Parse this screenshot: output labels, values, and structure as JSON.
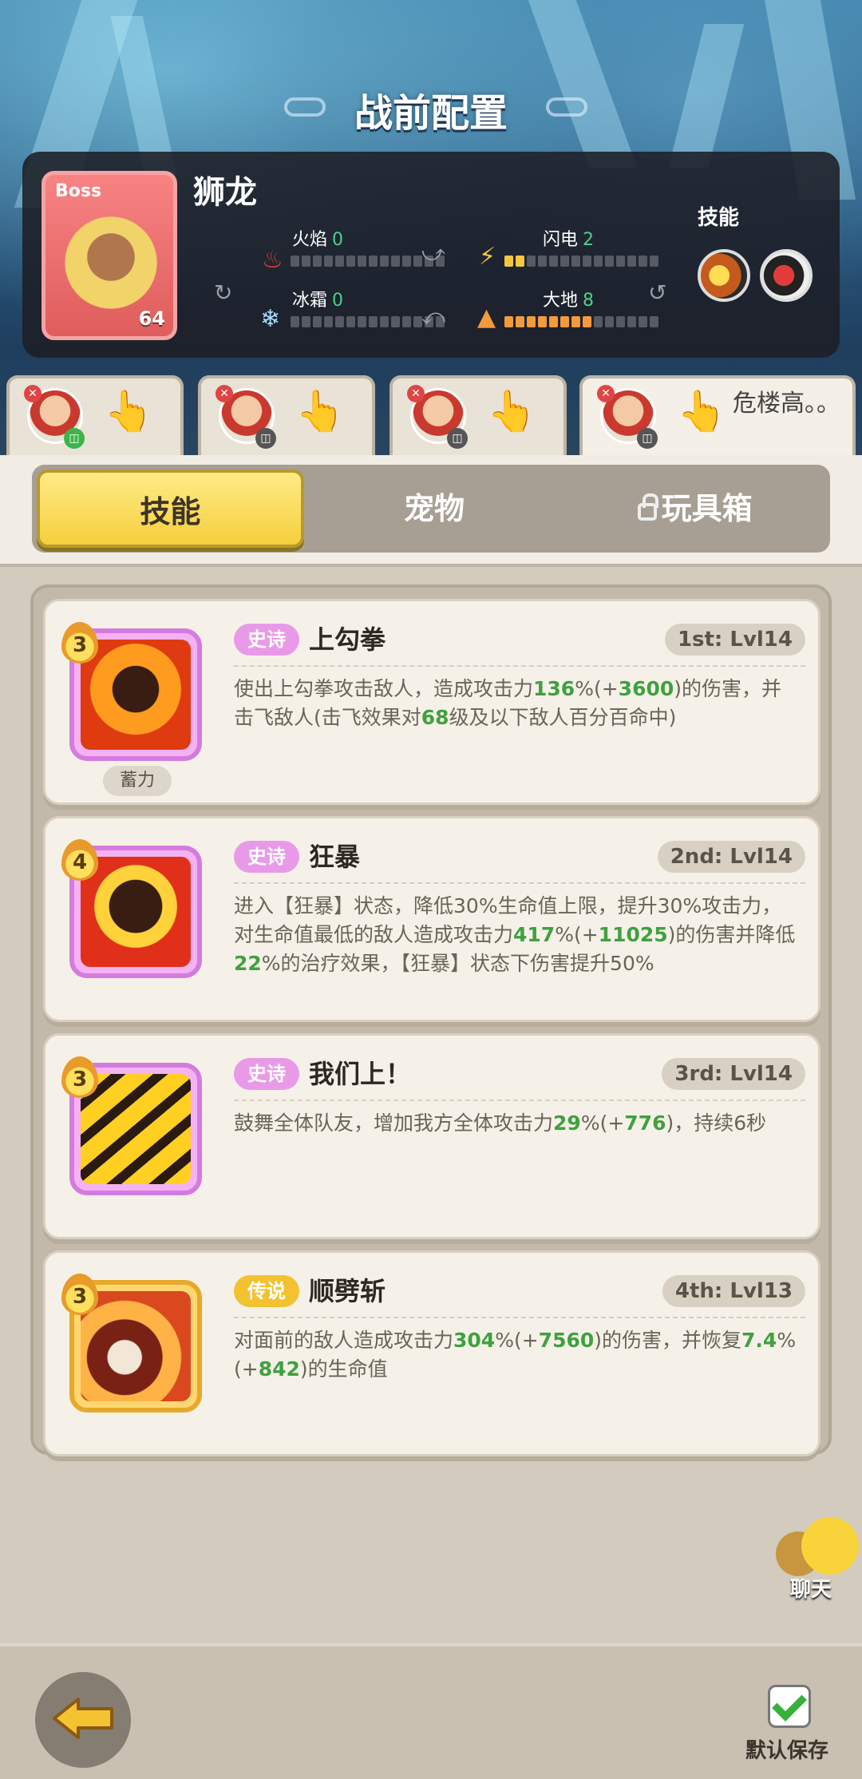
{
  "page": {
    "title": "战前配置"
  },
  "boss": {
    "tag": "Boss",
    "name": "狮龙",
    "level": "64",
    "elements": {
      "fire": {
        "label": "火焰",
        "value": "0"
      },
      "lightning": {
        "label": "闪电",
        "value": "2"
      },
      "frost": {
        "label": "冰霜",
        "value": "0"
      },
      "earth": {
        "label": "大地",
        "value": "8"
      }
    },
    "skills_label": "技能",
    "skill_orbs": [
      "4",
      "4"
    ]
  },
  "hero_tabs": [
    {
      "label": ""
    },
    {
      "label": ""
    },
    {
      "label": ""
    },
    {
      "label": "危楼高。。"
    }
  ],
  "segments": {
    "skills": "技能",
    "pets": "宠物",
    "toybox": "玩具箱"
  },
  "skills": [
    {
      "stars": "3",
      "rarity": "史诗",
      "name": "上勾拳",
      "level": "1st: Lvl14",
      "tag": "蓄力",
      "desc": [
        {
          "t": "使出上勾拳攻击敌人，造成攻击力"
        },
        {
          "t": "136",
          "g": true
        },
        {
          "t": "%(+"
        },
        {
          "t": "3600",
          "g": true
        },
        {
          "t": ")的伤害，并击飞敌人(击飞效果对"
        },
        {
          "t": "68",
          "g": true
        },
        {
          "t": "级及以下敌人百分百命中)"
        }
      ]
    },
    {
      "stars": "4",
      "rarity": "史诗",
      "name": "狂暴",
      "level": "2nd: Lvl14",
      "desc": [
        {
          "t": "进入【狂暴】状态，降低30%生命值上限，提升30%攻击力，对生命值最低的敌人造成攻击力"
        },
        {
          "t": "417",
          "g": true
        },
        {
          "t": "%(+"
        },
        {
          "t": "11025",
          "g": true
        },
        {
          "t": ")的伤害并降低"
        },
        {
          "t": "22",
          "g": true
        },
        {
          "t": "%的治疗效果，【狂暴】状态下伤害提升50%"
        }
      ]
    },
    {
      "stars": "3",
      "rarity": "史诗",
      "name": "我们上！",
      "level": "3rd: Lvl14",
      "desc": [
        {
          "t": "鼓舞全体队友，增加我方全体攻击力"
        },
        {
          "t": "29",
          "g": true
        },
        {
          "t": "%(+"
        },
        {
          "t": "776",
          "g": true
        },
        {
          "t": ")，持续6秒"
        }
      ]
    },
    {
      "stars": "3",
      "rarity": "传说",
      "name": "顺劈斩",
      "level": "4th: Lvl13",
      "desc": [
        {
          "t": "对面前的敌人造成攻击力"
        },
        {
          "t": "304",
          "g": true
        },
        {
          "t": "%(+"
        },
        {
          "t": "7560",
          "g": true
        },
        {
          "t": ")的伤害，并恢复"
        },
        {
          "t": "7.4",
          "g": true
        },
        {
          "t": "%(+"
        },
        {
          "t": "842",
          "g": true
        },
        {
          "t": ")的生命值"
        }
      ]
    }
  ],
  "chat": {
    "label": "聊天"
  },
  "footer": {
    "save_label": "默认保存"
  },
  "colors": {
    "accent_yellow": "#f5cf3d",
    "epic": "#e89ae8",
    "legend": "#f2c230",
    "green": "#3fa13f"
  }
}
